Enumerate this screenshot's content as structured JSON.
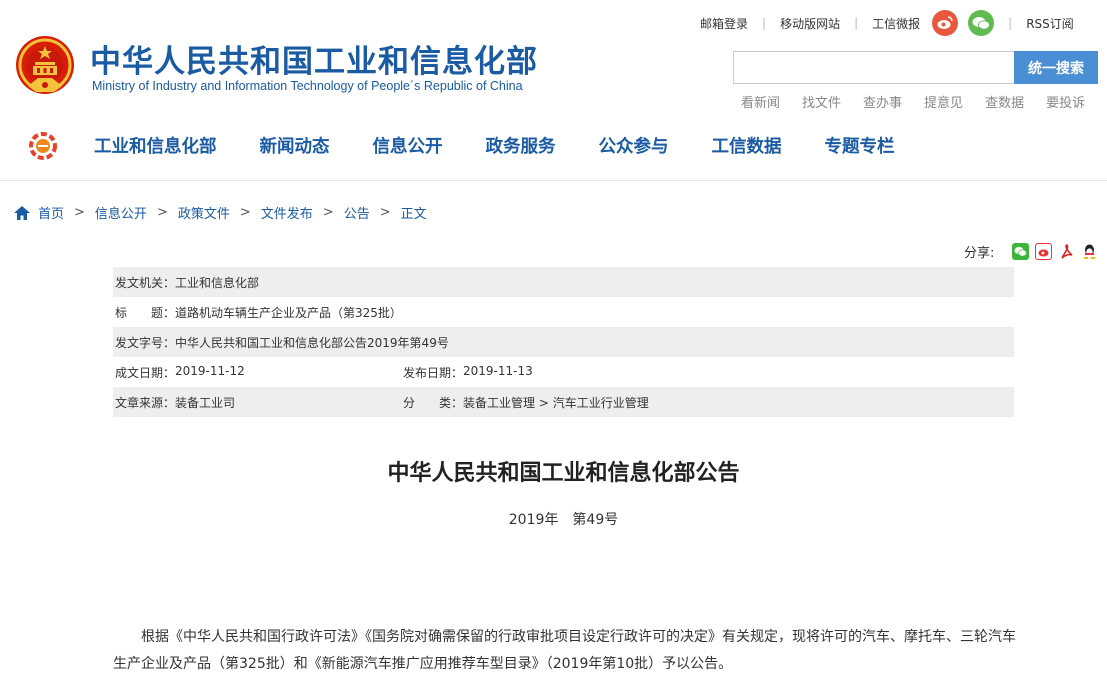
{
  "header": {
    "site_title": "中华人民共和国工业和信息化部",
    "site_subtitle": "Ministry of Industry and Information Technology of People´s Republic of China",
    "top_links": [
      "邮箱登录",
      "移动版网站",
      "工信微报"
    ],
    "rss": "RSS订阅",
    "weibo_icon": "weibo-icon",
    "wechat_icon": "wechat-icon",
    "search": {
      "value": "",
      "placeholder": "",
      "button_label": "统一搜索"
    },
    "quick_links": [
      "看新闻",
      "找文件",
      "查办事",
      "提意见",
      "查数据",
      "要投诉"
    ]
  },
  "nav": {
    "items": [
      "工业和信息化部",
      "新闻动态",
      "信息公开",
      "政务服务",
      "公众参与",
      "工信数据",
      "专题专栏"
    ]
  },
  "breadcrumb": {
    "items": [
      "首页",
      "信息公开",
      "政策文件",
      "文件发布",
      "公告"
    ],
    "current": "正文",
    "separator": ">"
  },
  "share": {
    "label": "分享:",
    "icons": [
      "wechat-share-icon",
      "weibo-share-icon",
      "pdf-icon",
      "qq-share-icon"
    ]
  },
  "meta": {
    "issuer_label": "发文机关：",
    "issuer": "工业和信息化部",
    "title_label": "标　　题：",
    "title": "道路机动车辆生产企业及产品（第325批）",
    "doc_no_label": "发文字号：",
    "doc_no": "中华人民共和国工业和信息化部公告2019年第49号",
    "created_label": "成文日期：",
    "created": "2019-11-12",
    "published_label": "发布日期：",
    "published": "2019-11-13",
    "source_label": "文章来源：",
    "source": "装备工业司",
    "category_label": "分　　类：",
    "category": "装备工业管理 > 汽车工业行业管理"
  },
  "article": {
    "title": "中华人民共和国工业和信息化部公告",
    "year": "2019年",
    "number": "第49号",
    "paragraph": "根据《中华人民共和国行政许可法》《国务院对确需保留的行政审批项目设定行政许可的决定》有关规定，现将许可的汽车、摩托车、三轮汽车生产企业及产品（第325批）和《新能源汽车推广应用推荐车型目录》（2019年第10批）予以公告。"
  },
  "colors": {
    "brand_blue": "#1a5ba3",
    "search_button": "#4a8fd6",
    "meta_row_grey": "#eeeeee",
    "weibo_red": "#e9573e",
    "wechat_green": "#5fba50"
  }
}
